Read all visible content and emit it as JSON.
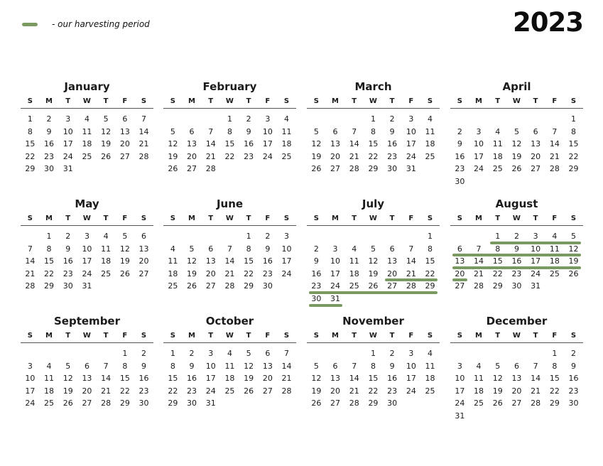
{
  "legend": {
    "text": "- our harvesting period",
    "color": "#7a9a62"
  },
  "year": "2023",
  "weekdays": [
    "S",
    "M",
    "T",
    "W",
    "T",
    "F",
    "S"
  ],
  "months": [
    {
      "name": "January",
      "start": 0,
      "days": 31
    },
    {
      "name": "February",
      "start": 3,
      "days": 28
    },
    {
      "name": "March",
      "start": 3,
      "days": 31
    },
    {
      "name": "April",
      "start": 6,
      "days": 30
    },
    {
      "name": "May",
      "start": 1,
      "days": 31
    },
    {
      "name": "June",
      "start": 4,
      "days": 30
    },
    {
      "name": "July",
      "start": 6,
      "days": 31,
      "harvest_days": [
        20,
        21,
        22,
        23,
        24,
        25,
        26,
        27,
        28,
        29,
        30,
        31
      ]
    },
    {
      "name": "August",
      "start": 2,
      "days": 31,
      "harvest_days": [
        1,
        2,
        3,
        4,
        5,
        6,
        7,
        8,
        9,
        10,
        11,
        12,
        13,
        14,
        15,
        16,
        17,
        18,
        19,
        20
      ]
    },
    {
      "name": "September",
      "start": 5,
      "days": 30
    },
    {
      "name": "October",
      "start": 0,
      "days": 31
    },
    {
      "name": "November",
      "start": 3,
      "days": 30
    },
    {
      "name": "December",
      "start": 5,
      "days": 31
    }
  ]
}
